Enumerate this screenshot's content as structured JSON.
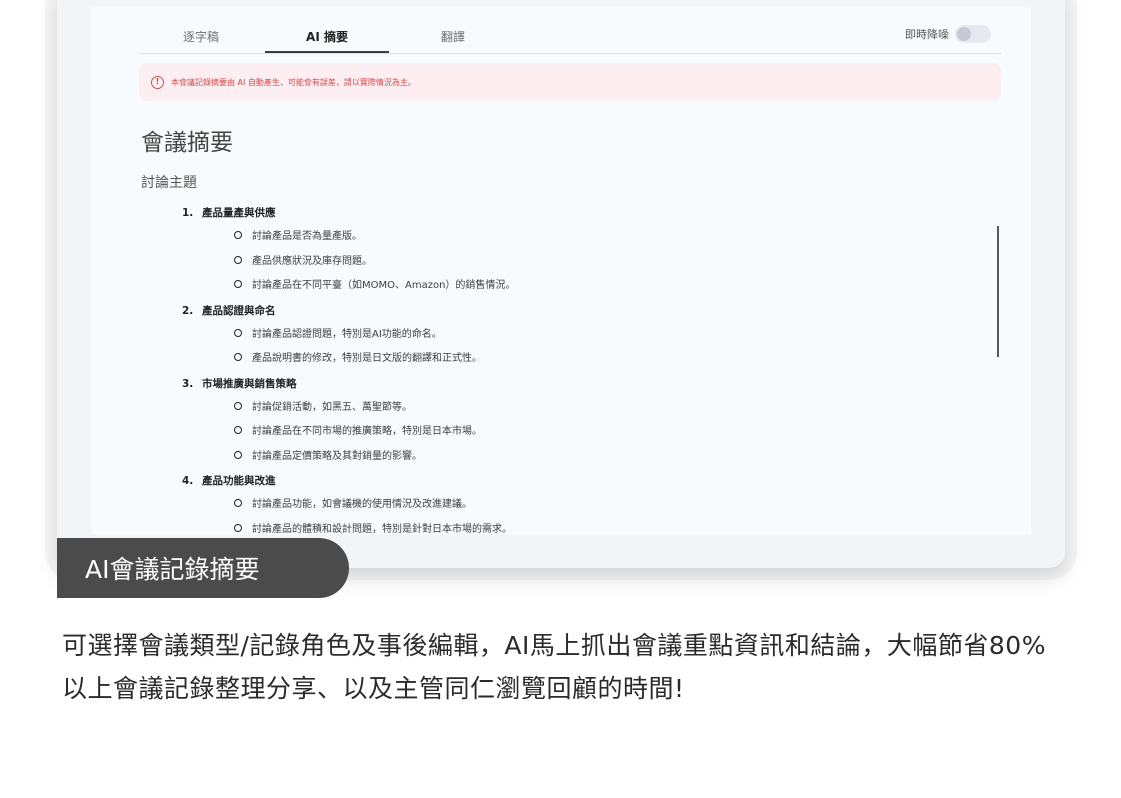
{
  "tabs": [
    {
      "label": "逐字稿"
    },
    {
      "label": "AI 摘要"
    },
    {
      "label": "翻譯"
    }
  ],
  "live_denoise_label": "即時降噪",
  "notice": {
    "icon": "exclamation-circle-icon",
    "text": "本會議記錄摘要由 AI 自動產生，可能會有誤差，請以實際情況為主。"
  },
  "summary": {
    "title": "會議摘要",
    "section_label": "討論主題",
    "topics": [
      {
        "number": "1.",
        "heading": "產品量產與供應",
        "items": [
          "討論產品是否為量產版。",
          "產品供應狀況及庫存問題。",
          "討論產品在不同平臺（如MOMO、Amazon）的銷售情況。"
        ]
      },
      {
        "number": "2.",
        "heading": "產品認證與命名",
        "items": [
          "討論產品認證問題，特別是AI功能的命名。",
          "產品說明書的修改，特別是日文版的翻譯和正式性。"
        ]
      },
      {
        "number": "3.",
        "heading": "市場推廣與銷售策略",
        "items": [
          "討論促銷活動，如黑五、萬聖節等。",
          "討論產品在不同市場的推廣策略，特別是日本市場。",
          "討論產品定價策略及其對銷量的影響。"
        ]
      },
      {
        "number": "4.",
        "heading": "產品功能與改進",
        "items": [
          "討論產品功能，如會議機的使用情況及改進建議。",
          "討論產品的體積和設計問題，特別是針對日本市場的需求。"
        ]
      }
    ]
  },
  "badge_label": "AI會議記錄摘要",
  "description": "可選擇會議類型/記錄角色及事後編輯，AI馬上抓出會議重點資訊和結論，大幅節省80%以上會議記錄整理分享、以及主管同仁瀏覽回顧的時間!"
}
